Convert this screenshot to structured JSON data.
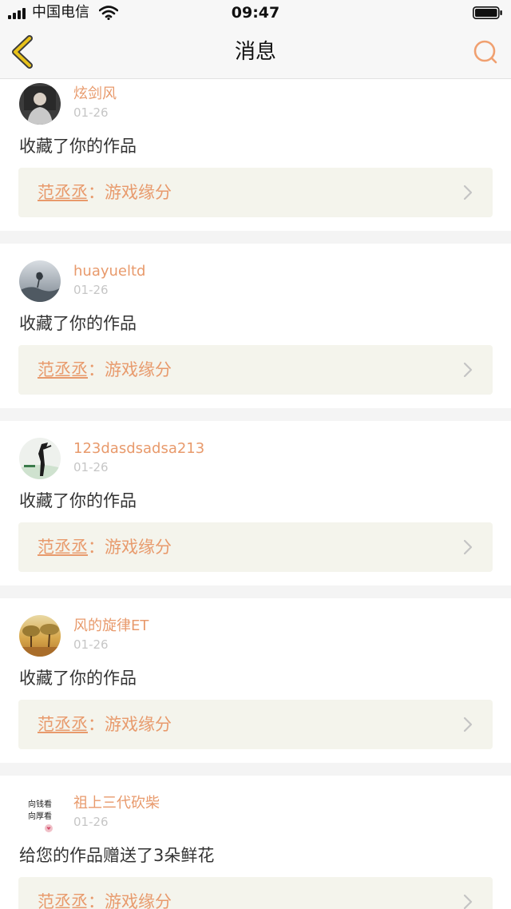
{
  "status_bar": {
    "carrier": "中国电信",
    "time": "09:47"
  },
  "nav": {
    "title": "消息",
    "back_icon": "chevron-left-icon",
    "search_icon": "search-icon"
  },
  "colors": {
    "accent": "#e89a6c",
    "back_arrow": "#e8c21a",
    "card_link_bg": "#f4f4ec",
    "separator": "#f4f4f4"
  },
  "messages": [
    {
      "user": "炫剑风",
      "date": "01-26",
      "text": "收藏了你的作品",
      "work_author": "范丞丞",
      "work_sep": "：",
      "work_title": "游戏缘分"
    },
    {
      "user": "huayueltd",
      "date": "01-26",
      "text": "收藏了你的作品",
      "work_author": "范丞丞",
      "work_sep": "：",
      "work_title": "游戏缘分"
    },
    {
      "user": "123dasdsadsa213",
      "date": "01-26",
      "text": "收藏了你的作品",
      "work_author": "范丞丞",
      "work_sep": "：",
      "work_title": "游戏缘分"
    },
    {
      "user": "风的旋律ET",
      "date": "01-26",
      "text": "收藏了你的作品",
      "work_author": "范丞丞",
      "work_sep": "：",
      "work_title": "游戏缘分"
    },
    {
      "user": "祖上三代砍柴",
      "date": "01-26",
      "text": "给您的作品赠送了3朵鲜花",
      "work_author": "范丞丞",
      "work_sep": "：",
      "work_title": "游戏缘分",
      "avatar_lines": [
        "向钱看",
        "向厚看"
      ]
    }
  ]
}
